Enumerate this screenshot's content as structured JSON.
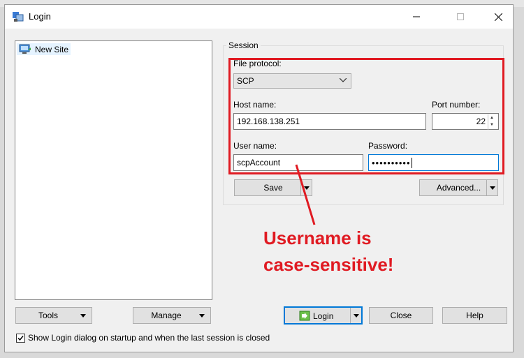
{
  "window": {
    "title": "Login",
    "controls": {
      "minimize": "—",
      "maximize": "☐",
      "close": "✕"
    }
  },
  "site_tree": {
    "items": [
      {
        "label": "New Site",
        "icon": "computer-icon",
        "selected": true
      }
    ]
  },
  "session": {
    "group_label": "Session",
    "file_protocol": {
      "label": "File protocol:",
      "value": "SCP"
    },
    "host": {
      "label": "Host name:",
      "value": "192.168.138.251"
    },
    "port": {
      "label": "Port number:",
      "value": "22"
    },
    "user": {
      "label": "User name:",
      "value": "scpAccount"
    },
    "password": {
      "label": "Password:",
      "masked_value": "••••••••••"
    },
    "save_label": "Save",
    "advanced_label": "Advanced..."
  },
  "bottom_buttons": {
    "tools": "Tools",
    "manage": "Manage",
    "login": "Login",
    "close": "Close",
    "help": "Help"
  },
  "checkbox": {
    "label": "Show Login dialog on startup and when the last session is closed",
    "checked": true
  },
  "annotation": {
    "line1": "Username is",
    "line2": "case-sensitive!",
    "color": "#e01a22"
  },
  "colors": {
    "accent": "#0078d7",
    "highlight": "#e01a22"
  }
}
